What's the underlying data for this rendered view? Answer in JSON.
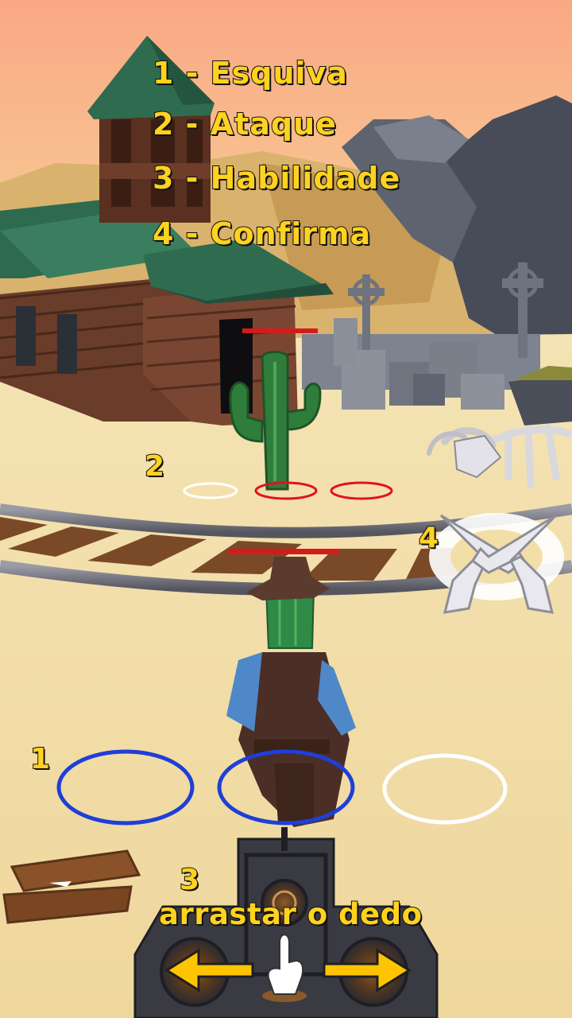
{
  "legend": {
    "items": [
      {
        "label": "1 - Esquiva"
      },
      {
        "label": "2 - Ataque"
      },
      {
        "label": "3 - Habilidade"
      },
      {
        "label": "4 - Confirma"
      }
    ]
  },
  "markers": {
    "dodge": "1",
    "attack": "2",
    "ability": "3",
    "confirm": "4"
  },
  "hint": {
    "drag_text": "arrastar o dedo"
  },
  "health": {
    "enemy_fraction": 1.0,
    "player_fraction": 1.0
  },
  "colors": {
    "label_yellow": "#FFD21F",
    "health_red": "#D41B1B",
    "dodge_ring_blue": "#1E3FD8",
    "target_ring_red": "#E0141B",
    "ring_white": "#FFFFFF",
    "sand": "#F2DFA8",
    "sky_top": "#F9A884"
  },
  "icons": {
    "confirm_button": "crossed-revolvers-icon",
    "ability_button": "cylinder-wheel-icon",
    "swipe_hand": "pointing-hand-icon",
    "arrow_left": "arrow-left-icon",
    "arrow_right": "arrow-right-icon"
  }
}
